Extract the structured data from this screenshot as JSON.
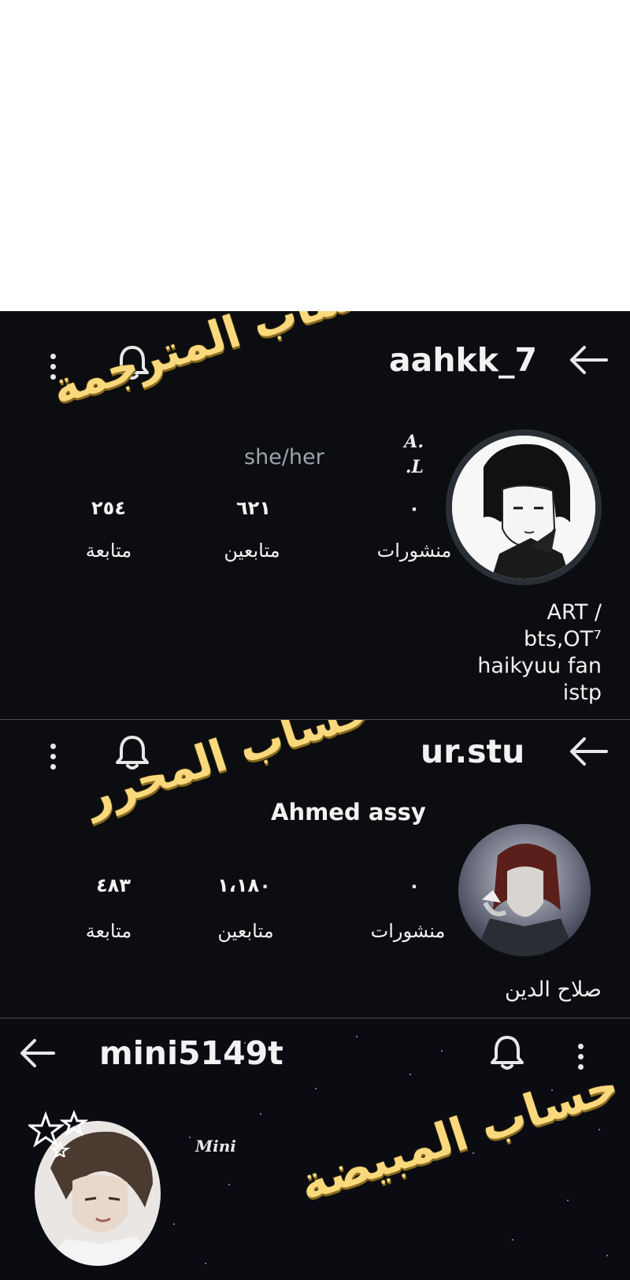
{
  "profiles": [
    {
      "username": "aahkk_7",
      "display_name": "A. .L",
      "pronouns": "she/her",
      "stats": [
        {
          "value": "٠",
          "label": "منشورات"
        },
        {
          "value": "٦٢١",
          "label": "متابعين"
        },
        {
          "value": "٢٥٤",
          "label": "متابعة"
        }
      ],
      "bio_lines": [
        "ART /",
        "bts,OT⁷",
        "haikyuu fan",
        "istp"
      ],
      "watermark": "حساب المترجمة"
    },
    {
      "username": "ur.stu",
      "display_name": "Ahmed assy",
      "stats": [
        {
          "value": "٠",
          "label": "منشورات"
        },
        {
          "value": "١،١٨٠",
          "label": "متابعين"
        },
        {
          "value": "٤٨٣",
          "label": "متابعة"
        }
      ],
      "bio_lines": [
        "صلاح الدين"
      ],
      "watermark": "حساب المحرر"
    },
    {
      "username": "mini5149t",
      "display_name": "Mini",
      "watermark": "حساب المبيضة"
    }
  ],
  "icons": {
    "back": "arrow-left-icon",
    "bell": "bell-icon",
    "more": "more-vertical-icon"
  },
  "colors": {
    "panel_bg": "#0b0d10",
    "watermark": "#f9d97c",
    "text": "#f2f2f2",
    "pronouns": "#9ea3ab"
  }
}
